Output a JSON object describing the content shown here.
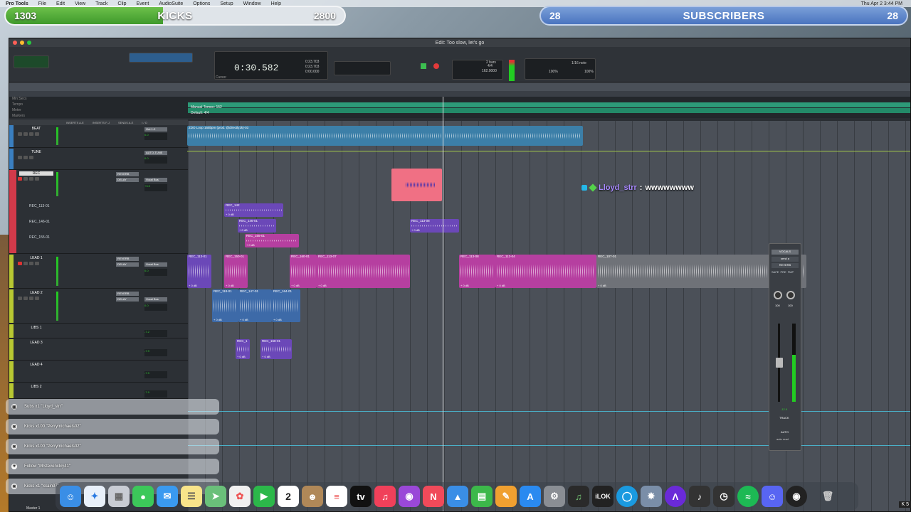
{
  "menubar": {
    "app": "Pro Tools",
    "items": [
      "File",
      "Edit",
      "View",
      "Track",
      "Clip",
      "Event",
      "AudioSuite",
      "Options",
      "Setup",
      "Window",
      "Help"
    ],
    "clock": "Thu Apr 2 3:44 PM"
  },
  "goals": {
    "kicks": {
      "current": "1303",
      "title": "KICKS",
      "target": "2800",
      "progress": 0.465
    },
    "subscribers": {
      "current": "28",
      "title": "SUBSCRIBERS",
      "target": "28",
      "progress": 1.0
    }
  },
  "window": {
    "title": "Edit: Too slow, let's go"
  },
  "transport": {
    "main_counter": "0:30.582",
    "sub_label": "Cursor",
    "start": "0:23.703",
    "end": "0:23.703",
    "length": "0:00.000",
    "grid_value": "1/16 note",
    "nudge_value": "1/16 note",
    "tempo": "162.0000",
    "meter": "4/4",
    "count_off": "2 bars",
    "strength": "100%",
    "swing": "100%"
  },
  "rulers": {
    "labels": [
      "Min:Secs",
      "Tempo",
      "Meter",
      "Markers"
    ],
    "tempo_text": "Manual Tempo: 152",
    "meter_text": "Default: 4/4"
  },
  "column_headers": [
    "INSERTS A-E",
    "INSERTS F-J",
    "SENDS A-E",
    "I / O"
  ],
  "tracks": [
    {
      "name": "BEAT",
      "color": "#3a7fc0",
      "io": "Out 1-2",
      "vol": "0.0"
    },
    {
      "name": "TUNE",
      "color": "#3a7fc0",
      "insert": "AUTO-TUNE",
      "vol": "0.0"
    },
    {
      "name": "REC",
      "color": "#d23a4a",
      "send1": "REVERB",
      "send2": "DELAY",
      "io": "Vocal Bus",
      "vol": "+3.0"
    },
    {
      "name": "LEAD 1",
      "color": "#b8c832",
      "send1": "REVERB",
      "send2": "DELAY",
      "io": "Vocal Bus",
      "vol": "0.0"
    },
    {
      "name": "LEAD 2",
      "color": "#b8c832",
      "send1": "REVERB",
      "send2": "DELAY",
      "io": "Vocal Bus",
      "vol": "0.0"
    },
    {
      "name": "LIBS 1",
      "color": "#b8c832",
      "vol": "-7.2"
    },
    {
      "name": "LEAD 3",
      "color": "#b8c832",
      "vol": "-7.9"
    },
    {
      "name": "LEAD 4",
      "color": "#b8c832",
      "vol": "-7.9"
    },
    {
      "name": "LIBS 2",
      "color": "#b8c832",
      "vol": "-7.9"
    }
  ],
  "playlist_lanes": [
    "REC_113-01",
    "REC_146-01",
    "REC_155-01"
  ],
  "clips": {
    "beat": "ZDO Loop 165bpm (prod. @directly1k)-03",
    "rec_pink": "",
    "rec_a": "REC_142",
    "rec_b": "REC_146-01",
    "rec_c": "REC_155-01",
    "rec_d": "REC_113-08",
    "lead1": [
      "REC_113-01",
      "REC_150-01",
      "REC_160-01",
      "REC_113-07",
      "REC_113-08",
      "REC_113-04",
      "REC_107-01"
    ],
    "lead2": [
      "REC_118-01",
      "REC_147-01",
      "REC_164-01"
    ],
    "lead3": [
      "REC_1",
      "REC_158-01"
    ],
    "gain": "+ 0 dB"
  },
  "mixer": {
    "name": "VOCALS",
    "send": "send a",
    "insert": "REVERB",
    "buttons": [
      "SAFE",
      "PRE",
      "FMP"
    ],
    "pan_l": "100",
    "pan_r": "100",
    "level": "-12.9",
    "track_label": "TRACK",
    "auto": "AUTO",
    "mode": "auto read"
  },
  "chat": {
    "user": "Lloyd_strr",
    "message": "wwwwwwww"
  },
  "events": [
    {
      "text": "Subs x1 \"Lloyd_strr\"",
      "icon": "gift"
    },
    {
      "text": "Kicks x100 \"Perrymichaels02\"",
      "icon": "k"
    },
    {
      "text": "Kicks x100 \"Perrymichaels02\"",
      "icon": "k"
    },
    {
      "text": "Follow \"Mrstevenclxy41\"",
      "icon": "heart"
    },
    {
      "text": "Kicks x1 \"kcain97\"",
      "icon": "k"
    }
  ],
  "bottom_track": "Master 1",
  "dock_date": "2",
  "corner_flag": "K 5",
  "colors": {
    "kicks_fill": "#4faf36",
    "subs": "#5a82c8",
    "lead_clip": "#b63fa0",
    "beat_clip": "#3c7fa8",
    "rec_clip": "#6b48b8",
    "lead2_clip": "#3d6aa8",
    "rec_pink": "#f07084"
  }
}
